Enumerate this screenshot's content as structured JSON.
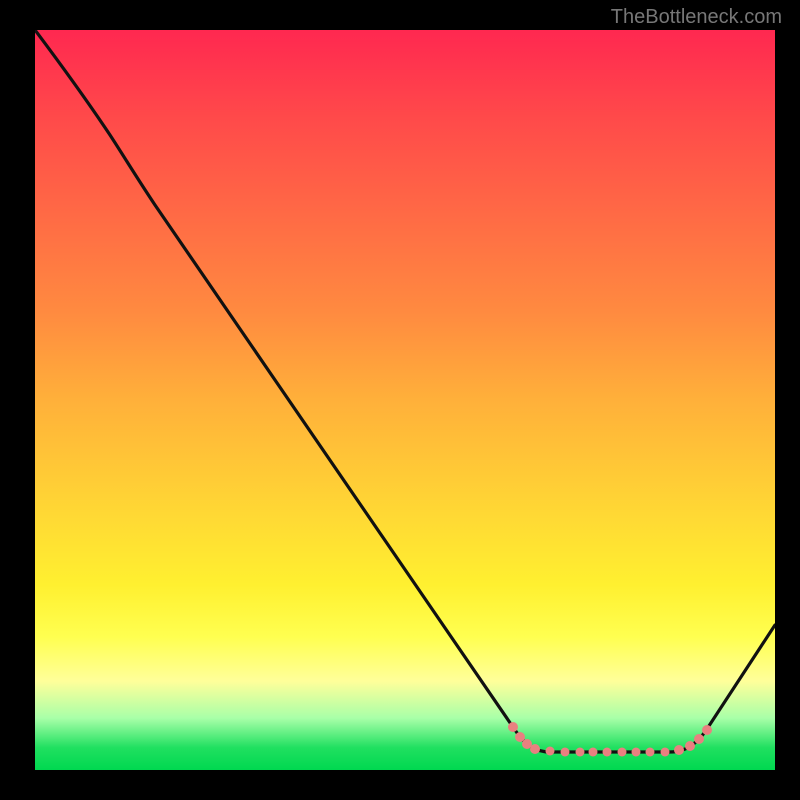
{
  "watermark": "TheBottleneck.com",
  "chart_data": {
    "type": "line",
    "title": "",
    "xlabel": "",
    "ylabel": "",
    "x_range_normalized": [
      0,
      100
    ],
    "y_range_normalized": [
      0,
      100
    ],
    "background_gradient_top_to_bottom": [
      "#ff2850",
      "#ff6a45",
      "#ffb03a",
      "#fff030",
      "#ffff9a",
      "#20e060"
    ],
    "series": [
      {
        "name": "bottleneck-curve",
        "x": [
          0,
          5,
          10,
          15,
          20,
          30,
          40,
          50,
          60,
          65,
          68,
          72,
          78,
          84,
          88,
          91,
          95,
          100
        ],
        "y": [
          100,
          94,
          88,
          82,
          76,
          62,
          48,
          34,
          20,
          10,
          5,
          2.5,
          2.3,
          2.3,
          2.5,
          5,
          12,
          20
        ],
        "note": "y is percentage height from bottom (0 = bottom/green, 100 = top/red); values estimated from pixels"
      }
    ],
    "optimal_zone": {
      "x_start": 65,
      "x_end": 91,
      "marker_color": "#e98080",
      "description": "flat valley region near bottom highlighted with salmon dots"
    },
    "legend": [],
    "annotations": []
  }
}
